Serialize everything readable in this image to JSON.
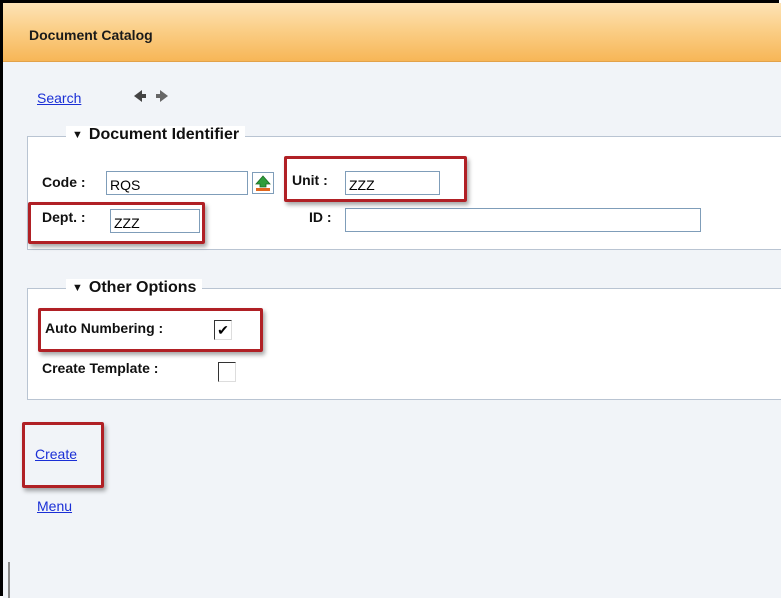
{
  "window": {
    "title": "Document Catalog"
  },
  "nav": {
    "search_label": "Search",
    "arrows_icon": "previous-next-arrows"
  },
  "doc_identifier": {
    "legend": "Document Identifier",
    "code_label": "Code :",
    "code_value": "RQS",
    "lookup_icon": "lookup-icon",
    "unit_label": "Unit :",
    "unit_value": "ZZZ",
    "dept_label": "Dept. :",
    "dept_value": "ZZZ",
    "id_label": "ID :",
    "id_value": ""
  },
  "other_options": {
    "legend": "Other Options",
    "auto_numbering_label": "Auto Numbering :",
    "auto_numbering_checked": true,
    "create_template_label": "Create Template :",
    "create_template_checked": false
  },
  "actions": {
    "create_label": "Create",
    "menu_label": "Menu"
  },
  "colors": {
    "highlight": "#b02025",
    "link": "#1a2fd6",
    "header": "#fbcf88"
  }
}
